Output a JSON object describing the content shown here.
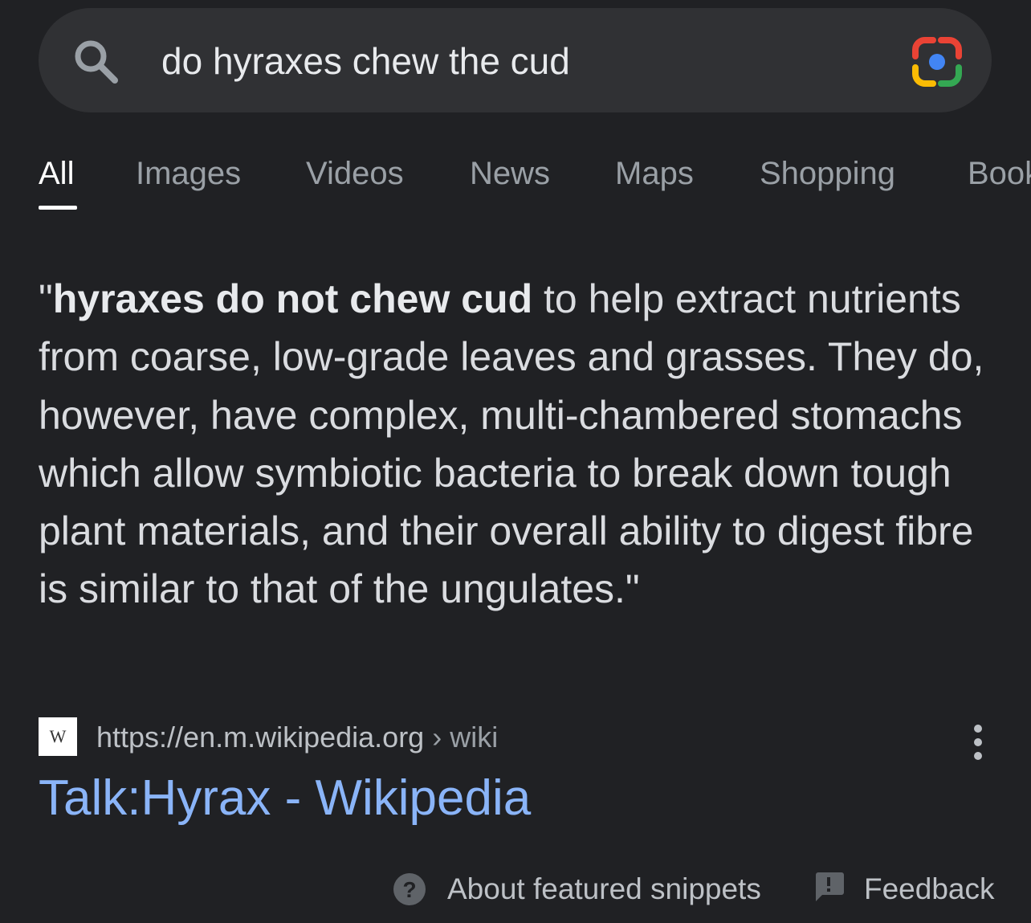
{
  "search": {
    "query": "do hyraxes chew the cud",
    "search_icon": "search-icon",
    "lens_icon": "google-lens-icon"
  },
  "tabs": [
    {
      "label": "All",
      "active": true
    },
    {
      "label": "Images"
    },
    {
      "label": "Videos"
    },
    {
      "label": "News"
    },
    {
      "label": "Maps"
    },
    {
      "label": "Shopping"
    },
    {
      "label": "Books"
    }
  ],
  "snippet": {
    "open_quote": "\"",
    "bold_text": "hyraxes do not chew cud",
    "rest_text": " to help extract nutrients from coarse, low-grade leaves and grasses. They do, however, have complex, multi-chambered stomachs which allow symbiotic bacteria to break down tough plant materials, and their overall ability to digest fibre is similar to that of the ungulates.\""
  },
  "source": {
    "favicon_text": "W",
    "url": "https://en.m.wikipedia.org",
    "breadcrumb": " › wiki",
    "title": "Talk:Hyrax - Wikipedia",
    "more_icon": "more-vert-icon"
  },
  "footer": {
    "about_label": "About featured snippets",
    "feedback_label": "Feedback",
    "help_icon": "help-icon",
    "feedback_icon": "feedback-icon"
  },
  "colors": {
    "background": "#202124",
    "search_bar": "#303134",
    "link": "#8ab4f8",
    "text_primary": "#e8eaed",
    "text_secondary": "#9aa0a6"
  }
}
